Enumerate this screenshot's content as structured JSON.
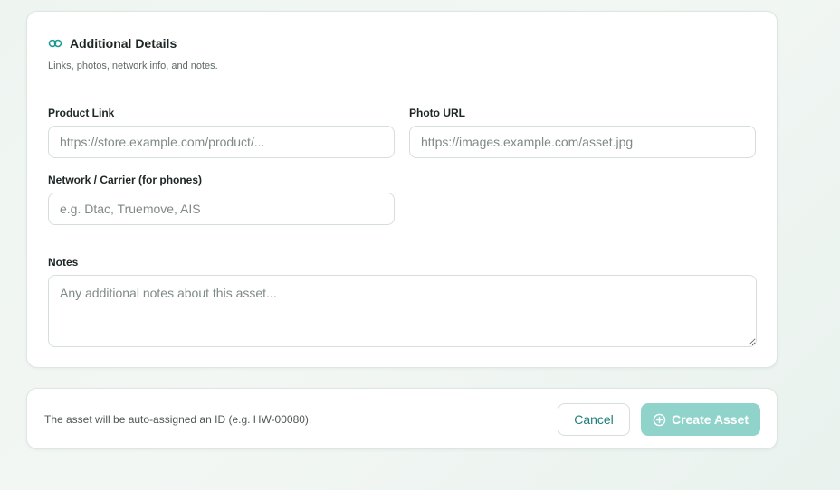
{
  "details": {
    "title": "Additional Details",
    "subtitle": "Links, photos, network info, and notes.",
    "icon": "link-icon",
    "accent_color": "#1b9a92",
    "product_link": {
      "label": "Product Link",
      "value": "",
      "placeholder": "https://store.example.com/product/..."
    },
    "photo_url": {
      "label": "Photo URL",
      "value": "",
      "placeholder": "https://images.example.com/asset.jpg"
    },
    "network": {
      "label": "Network / Carrier (for phones)",
      "value": "",
      "placeholder": "e.g. Dtac, Truemove, AIS"
    },
    "notes": {
      "label": "Notes",
      "value": "",
      "placeholder": "Any additional notes about this asset..."
    }
  },
  "footer": {
    "note": "The asset will be auto-assigned an ID (e.g. HW-00080).",
    "cancel_label": "Cancel",
    "create_label": "Create Asset",
    "create_icon": "plus-circle-icon",
    "create_color": "#8fd3cb"
  }
}
